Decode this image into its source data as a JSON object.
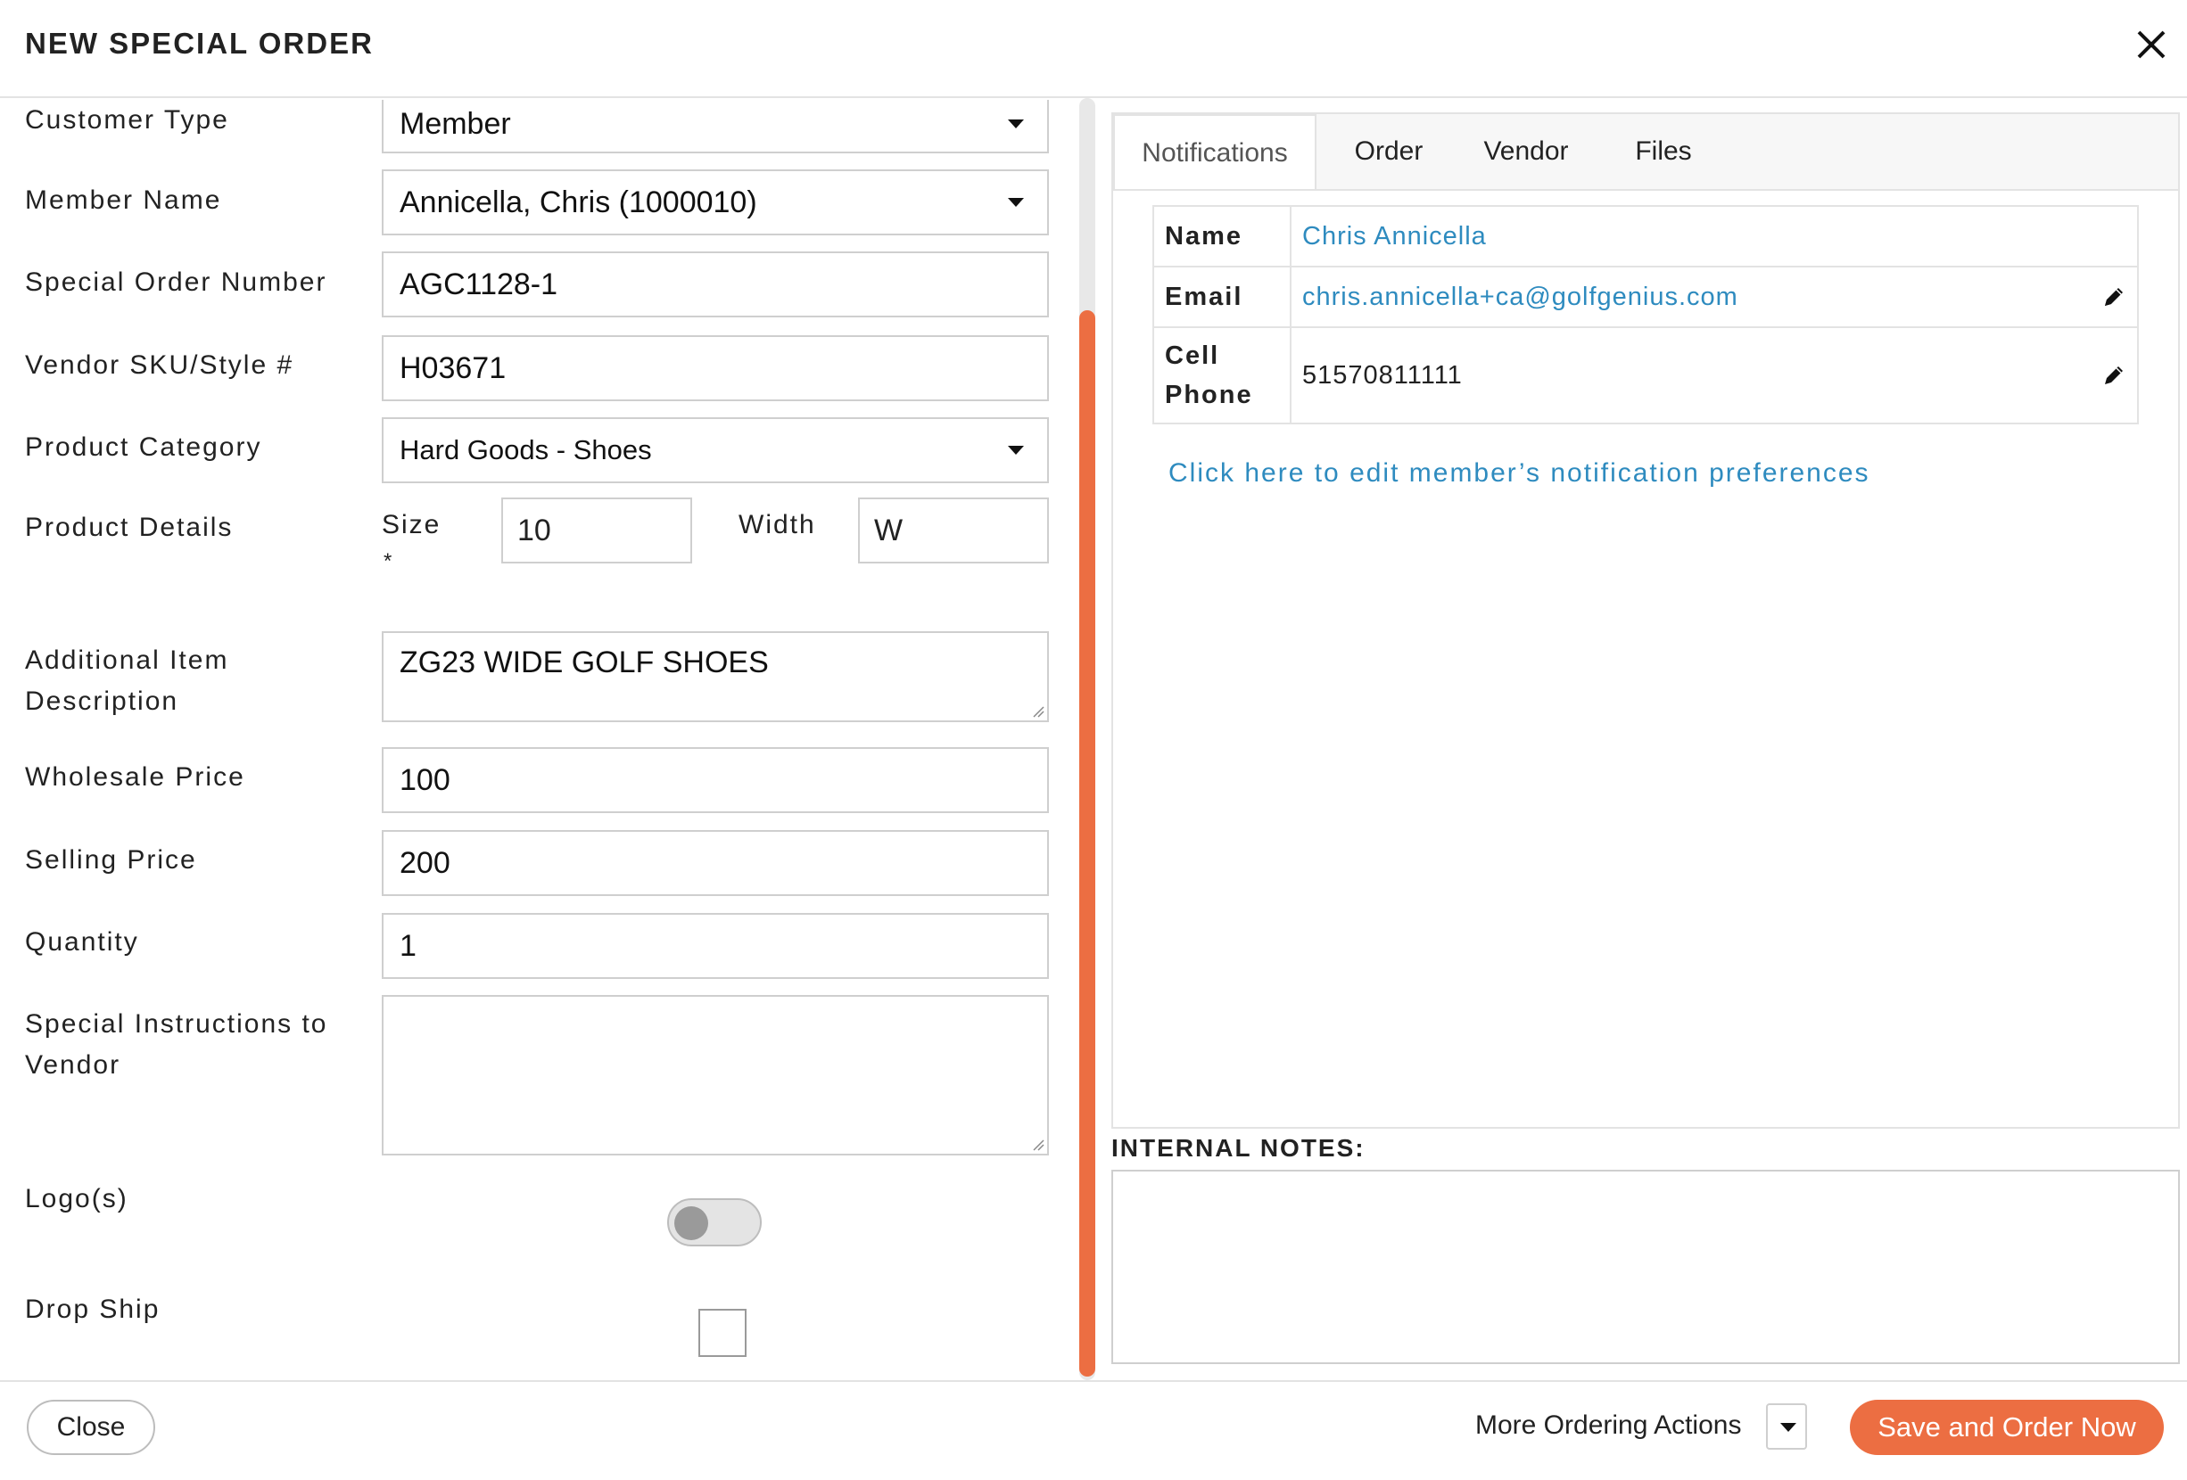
{
  "dialog": {
    "title": "NEW SPECIAL ORDER"
  },
  "form": {
    "customer_type": {
      "label": "Customer Type",
      "value": "Member"
    },
    "member_name": {
      "label": "Member Name",
      "value": "Annicella, Chris (1000010)"
    },
    "special_order_number": {
      "label": "Special Order Number",
      "value": "AGC1128-1"
    },
    "vendor_sku": {
      "label": "Vendor SKU/Style #",
      "value": "H03671"
    },
    "product_category": {
      "label": "Product Category",
      "value": "Hard Goods - Shoes"
    },
    "product_details": {
      "label": "Product Details",
      "size_label": "Size",
      "size_required": "*",
      "size_value": "10",
      "width_label": "Width",
      "width_value": "W"
    },
    "additional_description": {
      "label_line1": "Additional Item",
      "label_line2": "Description",
      "value": "ZG23 WIDE GOLF SHOES"
    },
    "wholesale_price": {
      "label": "Wholesale Price",
      "value": "100"
    },
    "selling_price": {
      "label": "Selling Price",
      "value": "200"
    },
    "quantity": {
      "label": "Quantity",
      "value": "1"
    },
    "special_instructions": {
      "label_line1": "Special Instructions to",
      "label_line2": "Vendor",
      "value": ""
    },
    "logos": {
      "label": "Logo(s)",
      "enabled": false
    },
    "drop_ship": {
      "label": "Drop Ship",
      "checked": false
    }
  },
  "tabs": [
    {
      "label": "Notifications",
      "active": true
    },
    {
      "label": "Order",
      "active": false
    },
    {
      "label": "Vendor",
      "active": false
    },
    {
      "label": "Files",
      "active": false
    }
  ],
  "notifications": {
    "name_label": "Name",
    "name_value": "Chris Annicella",
    "email_label": "Email",
    "email_value": "chris.annicella+ca@golfgenius.com",
    "cell_label_line1": "Cell",
    "cell_label_line2": "Phone",
    "cell_value": "51570811111",
    "preferences_link": "Click here to edit member’s notification preferences"
  },
  "internal_notes": {
    "label": "INTERNAL NOTES:",
    "value": ""
  },
  "footer": {
    "close_label": "Close",
    "more_actions_label": "More Ordering Actions",
    "save_label": "Save and Order Now"
  },
  "colors": {
    "accent": "#ec6e42",
    "link": "#2e8bbf"
  },
  "icons": [
    "close-icon",
    "chevron-down-icon",
    "pencil-icon",
    "resize-grip-icon"
  ]
}
